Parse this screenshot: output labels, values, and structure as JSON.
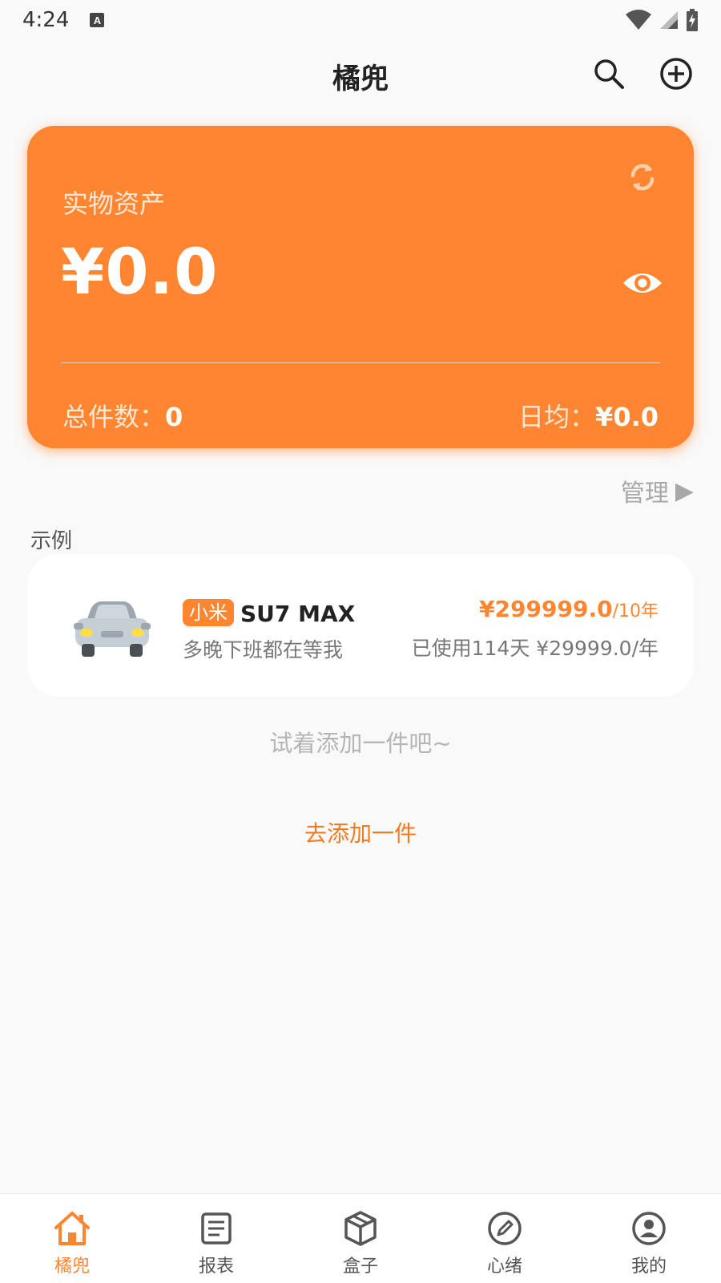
{
  "status_bar": {
    "time": "4:24",
    "notification_icon": "A"
  },
  "app_bar": {
    "title": "橘兜",
    "search_icon": "search-icon",
    "add_icon": "add-circle-icon"
  },
  "asset_card": {
    "label": "实物资产",
    "value": "¥0.0",
    "total_count_label": "总件数：",
    "total_count_value": "0",
    "daily_avg_label": "日均：",
    "daily_avg_value": "¥0.0",
    "accent_color": "#ff8531"
  },
  "manage": {
    "label": "管理",
    "arrow": "▶"
  },
  "example_section": {
    "label": "示例",
    "item": {
      "brand": "小米",
      "name": "SU7 MAX",
      "description": "多晚下班都在等我",
      "price": "¥299999.0",
      "period": "/10年",
      "usage": "已使用114天 ¥29999.0/年"
    }
  },
  "empty_hint": "试着添加一件吧~",
  "add_link": "去添加一件",
  "bottom_nav": {
    "items": [
      {
        "label": "橘兜",
        "icon": "home-icon",
        "active": true
      },
      {
        "label": "报表",
        "icon": "report-icon",
        "active": false
      },
      {
        "label": "盒子",
        "icon": "box-icon",
        "active": false
      },
      {
        "label": "心绪",
        "icon": "pencil-circle-icon",
        "active": false
      },
      {
        "label": "我的",
        "icon": "profile-icon",
        "active": false
      }
    ]
  }
}
